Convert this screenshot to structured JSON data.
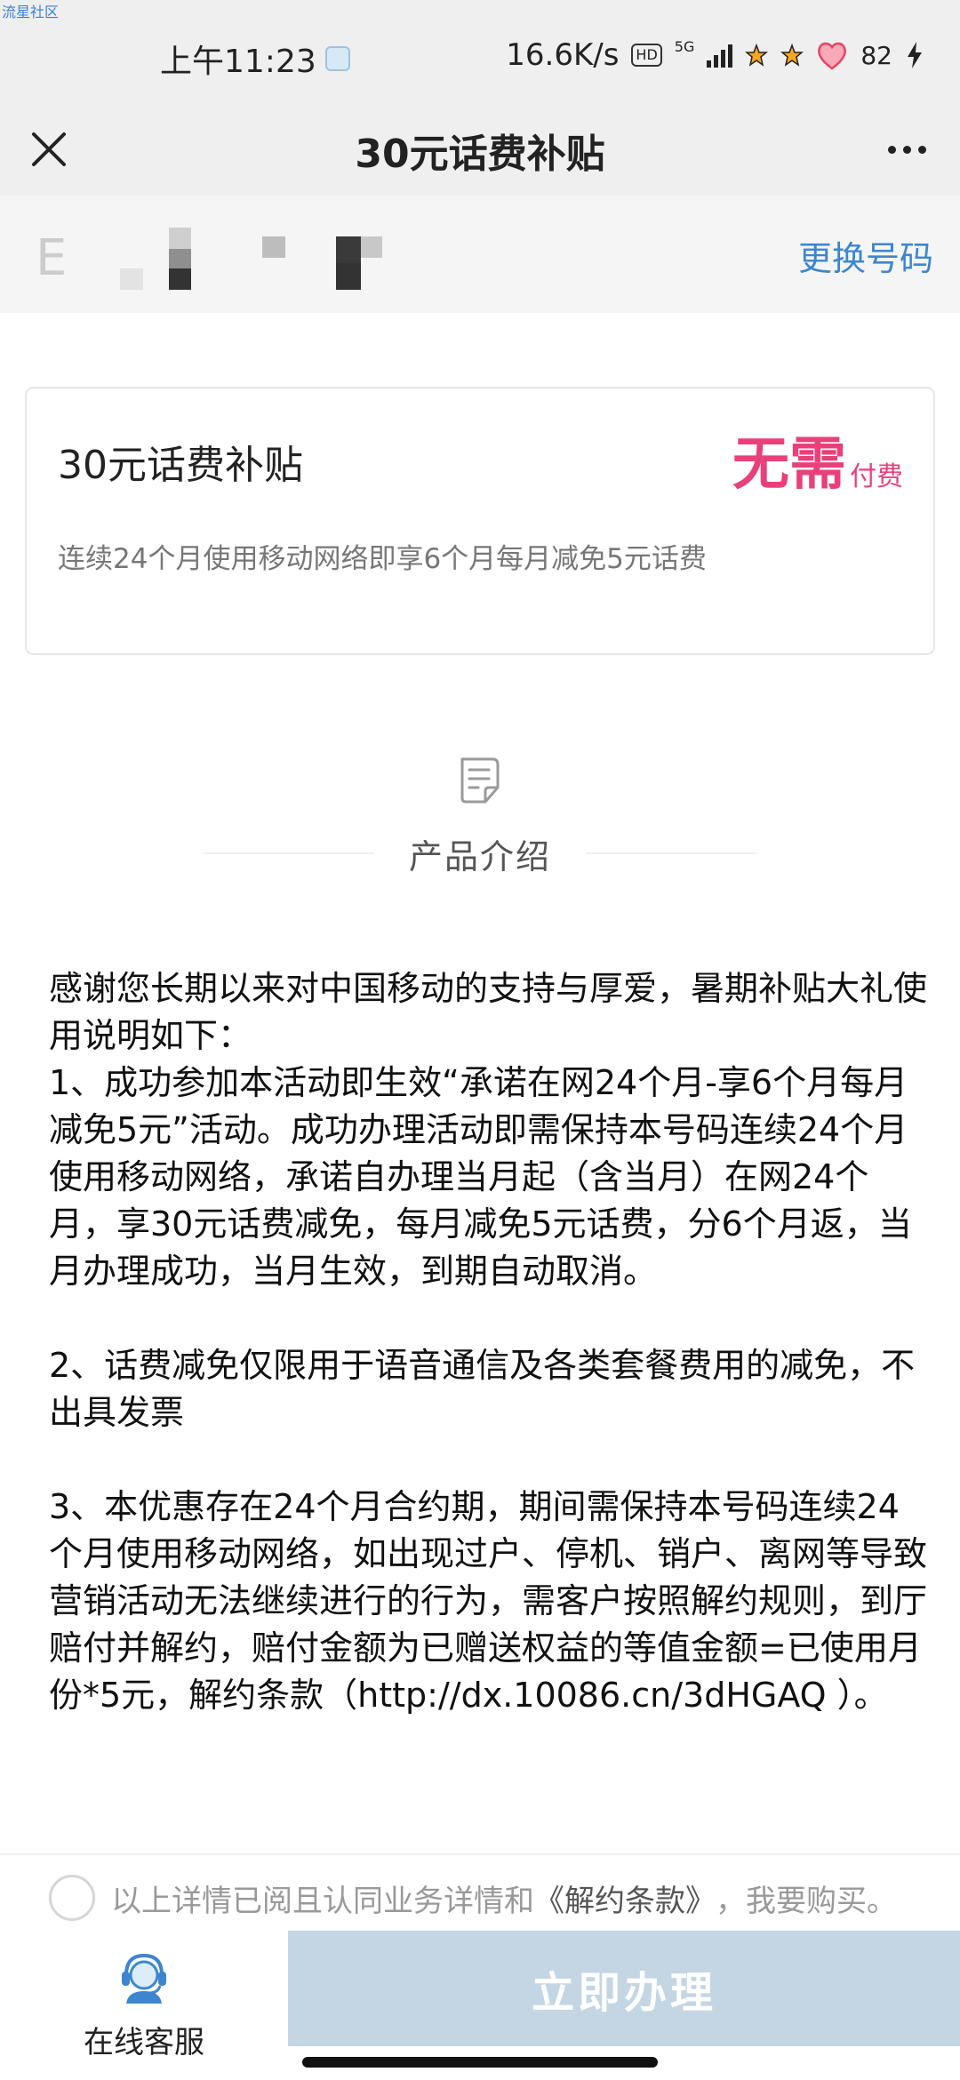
{
  "watermark": "流星社区",
  "status_bar": {
    "time": "上午11:23",
    "net_speed": "16.6K/s",
    "hd": "HD",
    "net_type": "5G",
    "battery_level": "82"
  },
  "nav": {
    "title": "30元话费补贴"
  },
  "account": {
    "phone_prefix": "E",
    "change_number_label": "更换号码"
  },
  "product": {
    "name": "30元话费补贴",
    "price_big": "无需",
    "price_small": "付费",
    "description": "连续24个月使用移动网络即享6个月每月减免5元话费"
  },
  "intro": {
    "title": "产品介绍"
  },
  "rules": {
    "p1": "感谢您长期以来对中国移动的支持与厚爱，暑期补贴大礼使用说明如下：",
    "p2": "1、成功参加本活动即生效“承诺在网24个月-享6个月每月减免5元”活动。成功办理活动即需保持本号码连续24个月使用移动网络，承诺自办理当月起（含当月）在网24个月，享30元话费减免，每月减免5元话费，分6个月返，当月办理成功，当月生效，到期自动取消。",
    "p3": "2、话费减免仅限用于语音通信及各类套餐费用的减免，不出具发票",
    "p4": "3、本优惠存在24个月合约期，期间需保持本号码连续24个月使用移动网络，如出现过户、停机、销户、离网等导致营销活动无法继续进行的行为，需客户按照解约规则，到厅赔付并解约，赔付金额为已赠送权益的等值金额=已使用月份*5元，解约条款（http://dx.10086.cn/3dHGAQ ）。"
  },
  "agreement": {
    "prefix": "以上详情已阅且认同业务详情和",
    "link": "《解约条款》",
    "suffix": "，我要购买。"
  },
  "bottom": {
    "service_label": "在线客服",
    "apply_label": "立即办理"
  },
  "colors": {
    "accent_blue": "#3d86cf",
    "price_pink": "#e8417a",
    "button_disabled": "#c4d6e4"
  }
}
